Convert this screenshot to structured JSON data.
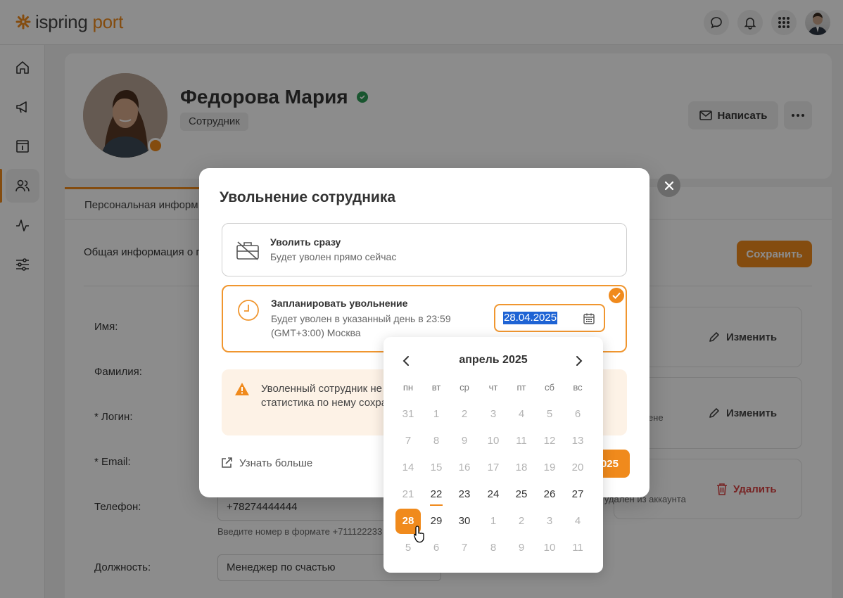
{
  "colors": {
    "accent": "#f08a1c",
    "danger": "#d94040",
    "success": "#2e9b56",
    "selection": "#1e63d4"
  },
  "app": {
    "logo_main": "ispring",
    "logo_sub": "port"
  },
  "topbar": {
    "icons": [
      "chat-icon",
      "bell-icon",
      "apps-grid-icon",
      "user-avatar"
    ]
  },
  "sidebar": {
    "items": [
      "home-icon",
      "megaphone-icon",
      "info-book-icon",
      "users-icon",
      "activity-icon",
      "sliders-icon"
    ]
  },
  "profile": {
    "name": "Федорова Мария",
    "role": "Сотрудник",
    "write_label": "Написать"
  },
  "tabs": {
    "active": "Персональная информ"
  },
  "content": {
    "section_title": "Общая информация о п",
    "save_label": "Сохранить",
    "fields": {
      "name_label": "Имя:",
      "surname_label": "Фамилия:",
      "login_label": "*  Логин:",
      "email_label": "*  Email:",
      "phone_label": "Телефон:",
      "phone_value": "+78274444444",
      "phone_hint": "Введите номер в формате +711122233",
      "position_label": "Должность:",
      "position_value": "Менеджер по счастью"
    },
    "side": {
      "edit_label_1": "Изменить",
      "edit_label_2": "Изменить",
      "note_1": "мене",
      "delete_label": "Удалить",
      "note_2": "а удален из аккаунта"
    }
  },
  "modal": {
    "title": "Увольнение сотрудника",
    "option_now": {
      "title": "Уволить сразу",
      "desc": "Будет уволен прямо сейчас"
    },
    "option_scheduled": {
      "title": "Запланировать увольнение",
      "desc": "Будет уволен в указанный день в 23:59 (GMT+3:00) Москва",
      "date_value": "28.04.2025"
    },
    "warning": "Уволенный сотрудник не будет показываться в Оргструктуре, а статистика по нему сохранится.",
    "learn_more": "Узнать больше",
    "confirm_label": "2025"
  },
  "calendar": {
    "month": "апрель 2025",
    "weekdays": [
      "пн",
      "вт",
      "ср",
      "чт",
      "пт",
      "сб",
      "вс"
    ],
    "weeks": [
      [
        "31",
        "1",
        "2",
        "3",
        "4",
        "5",
        "6"
      ],
      [
        "7",
        "8",
        "9",
        "10",
        "11",
        "12",
        "13"
      ],
      [
        "14",
        "15",
        "16",
        "17",
        "18",
        "19",
        "20"
      ],
      [
        "21",
        "22",
        "23",
        "24",
        "25",
        "26",
        "27"
      ],
      [
        "28",
        "29",
        "30",
        "1",
        "2",
        "3",
        "4"
      ],
      [
        "5",
        "6",
        "7",
        "8",
        "9",
        "10",
        "11"
      ]
    ],
    "selected": "28",
    "today": "22"
  }
}
